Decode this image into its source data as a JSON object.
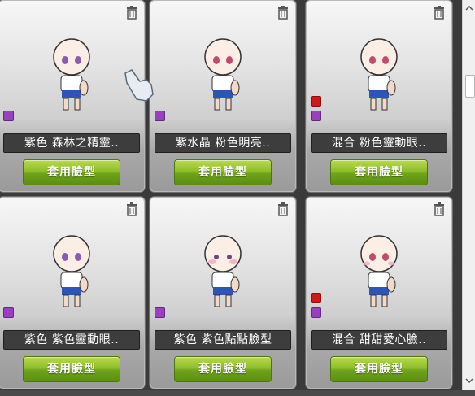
{
  "apply_label": "套用臉型",
  "cards": [
    {
      "name": "紫色 森林之精靈..",
      "eye_color": "#8a5ab5",
      "swatches": [
        "#9a3fc0"
      ]
    },
    {
      "name": "紫水晶 粉色明亮..",
      "eye_color": "#c24a6a",
      "swatches": [
        "#9a3fc0"
      ]
    },
    {
      "name": "混合 粉色靈動眼..",
      "eye_color": "#c24a6a",
      "swatches": [
        "#d01818",
        "#9a3fc0"
      ]
    },
    {
      "name": "紫色 紫色靈動眼..",
      "eye_color": "#8a5ab5",
      "swatches": [
        "#9a3fc0"
      ]
    },
    {
      "name": "紫色 紫色點點臉型",
      "eye_color": "#6a4a7a",
      "swatches": [
        "#9a3fc0"
      ]
    },
    {
      "name": "混合 甜甜愛心臉..",
      "eye_color": "#c24a6a",
      "swatches": [
        "#d01818",
        "#9a3fc0"
      ]
    }
  ],
  "colors": {
    "button_green": "#7fb221",
    "label_bg": "#3d3d3d",
    "card_top": "#f7f7f7"
  }
}
